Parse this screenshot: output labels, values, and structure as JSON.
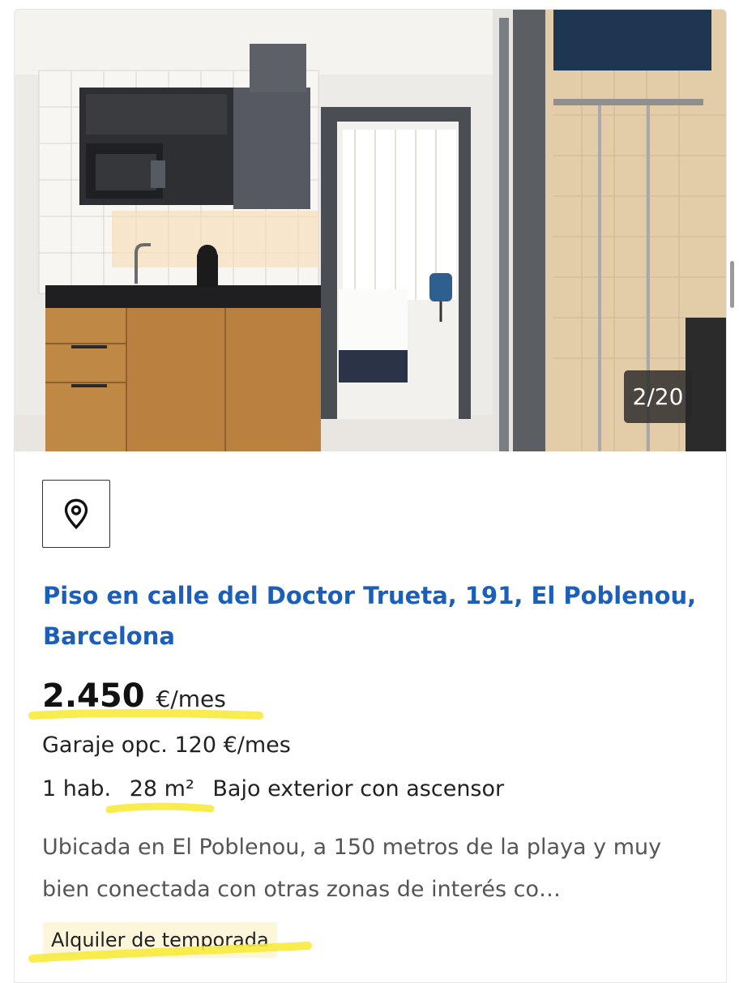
{
  "listing": {
    "photo_counter": "2/20",
    "map_button_icon": "location-pin-icon",
    "title": "Piso en calle del Doctor Trueta, 191, El Poblenou, Barcelona",
    "price_amount": "2.450",
    "price_unit": "€/mes",
    "parking": "Garaje opc. 120 €/mes",
    "rooms": "1 hab.",
    "area": "28 m²",
    "floor": "Bajo exterior con ascensor",
    "description": "Ubicada en El Poblenou, a 150 metros de la playa y muy bien conectada con otras zonas de interés co…",
    "tag": "Alquiler de temporada"
  },
  "colors": {
    "title_link": "#1c5fb8",
    "highlighter": "#f7ea3c",
    "tag_bg": "#fef6da"
  }
}
